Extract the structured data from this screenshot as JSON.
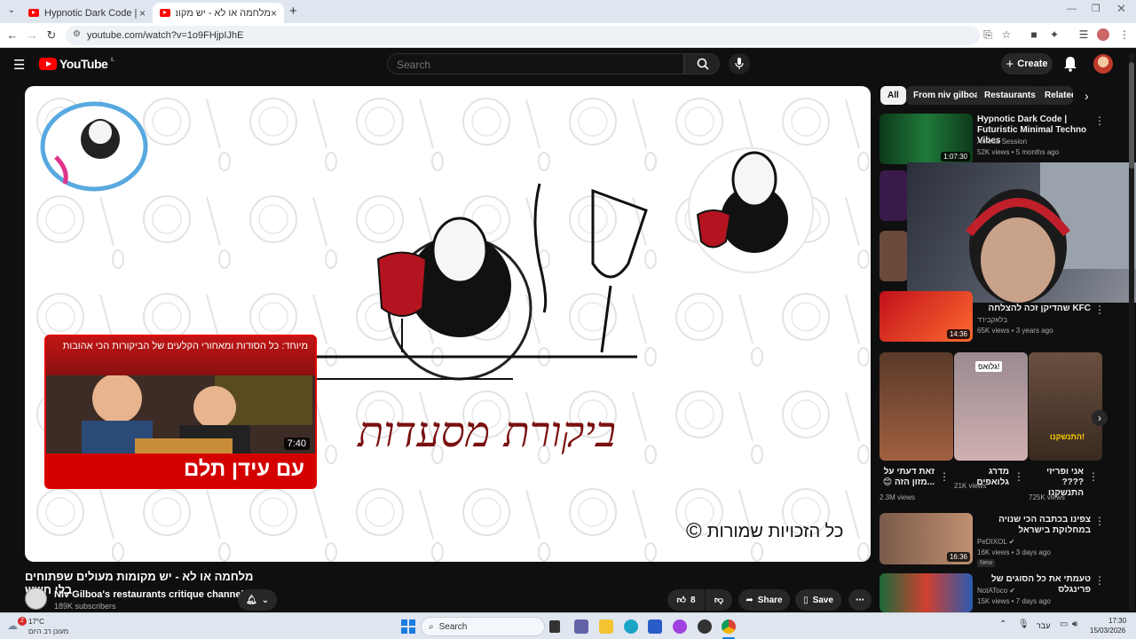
{
  "browser": {
    "tabs": [
      {
        "title": "Hypnotic Dark Code | Futuristic",
        "active": false
      },
      {
        "title": "מלחמה או לא - יש מקומות מעו",
        "active": true
      }
    ],
    "url": "youtube.com/watch?v=1o9FHjpIJhE"
  },
  "youtube": {
    "logo_text": "YouTube",
    "logo_region": "IL",
    "search_placeholder": "Search",
    "create_label": "Create"
  },
  "player": {
    "endcard": {
      "caption": "מיוחד: כל הסודות ומאחורי הקלעים של הביקורות הכי אהובות",
      "bottom_text": "עם עידן תלם",
      "duration": "7:40"
    },
    "title_art": "ביקורת מסעדות",
    "copyright_text": "כל הזכויות שמורות",
    "copyright_symbol": "©"
  },
  "video": {
    "title": "מלחמה או לא - יש מקומות מעולים שפתוחים בלי חשש",
    "channel": "Niv Gilboa's restaurants critique channel",
    "verified_icon": "check-circle-icon",
    "subscribers": "189K subscribers",
    "likes": "8",
    "share_label": "Share",
    "save_label": "Save"
  },
  "sidebar": {
    "chips": [
      "All",
      "From niv gilboa",
      "Restaurants",
      "Related"
    ],
    "items": [
      {
        "title": "Hypnotic Dark Code | Futuristic Minimal Techno Vibes",
        "channel": "Amoda Session",
        "meta": "52K views • 5 months ago",
        "duration": "1:07:30"
      },
      {
        "title": "KFC שהדיקן זכה להצלחה",
        "channel": "בלאקבירד",
        "meta": "65K views • 3 years ago",
        "duration": "14:36"
      }
    ],
    "shorts": [
      {
        "title": "זאת דעתי על ...מזון הזה 😊",
        "views": "2.3M views",
        "overlay": ""
      },
      {
        "title": "מדרג גלואפים",
        "views": "21K views",
        "overlay": "גלואפ!"
      },
      {
        "title": "אני ופריזי ????התנשקנו",
        "views": "725K views",
        "overlay": "התנשקנו!"
      }
    ],
    "items2": [
      {
        "title": "צפינו בכתבה הכי שנויה במחלוקת בישראל",
        "channel": "PeDIXOL",
        "meta": "16K views • 3 days ago",
        "badge": "New",
        "duration": "16:36"
      },
      {
        "title": "טעמתי את כל הסוגים של פרינגלס",
        "channel": "NotAToco",
        "meta": "15K views • 7 days ago"
      }
    ]
  },
  "taskbar": {
    "weather_temp": "17°C",
    "weather_desc": "מעונן רב היום",
    "search_label": "Search",
    "time": "17:30",
    "date": "15/03/2026",
    "lang": "עבר"
  },
  "colors": {
    "yt_red": "#ff0000",
    "yt_bg": "#0f0f0f",
    "chip_bg": "#272727"
  }
}
